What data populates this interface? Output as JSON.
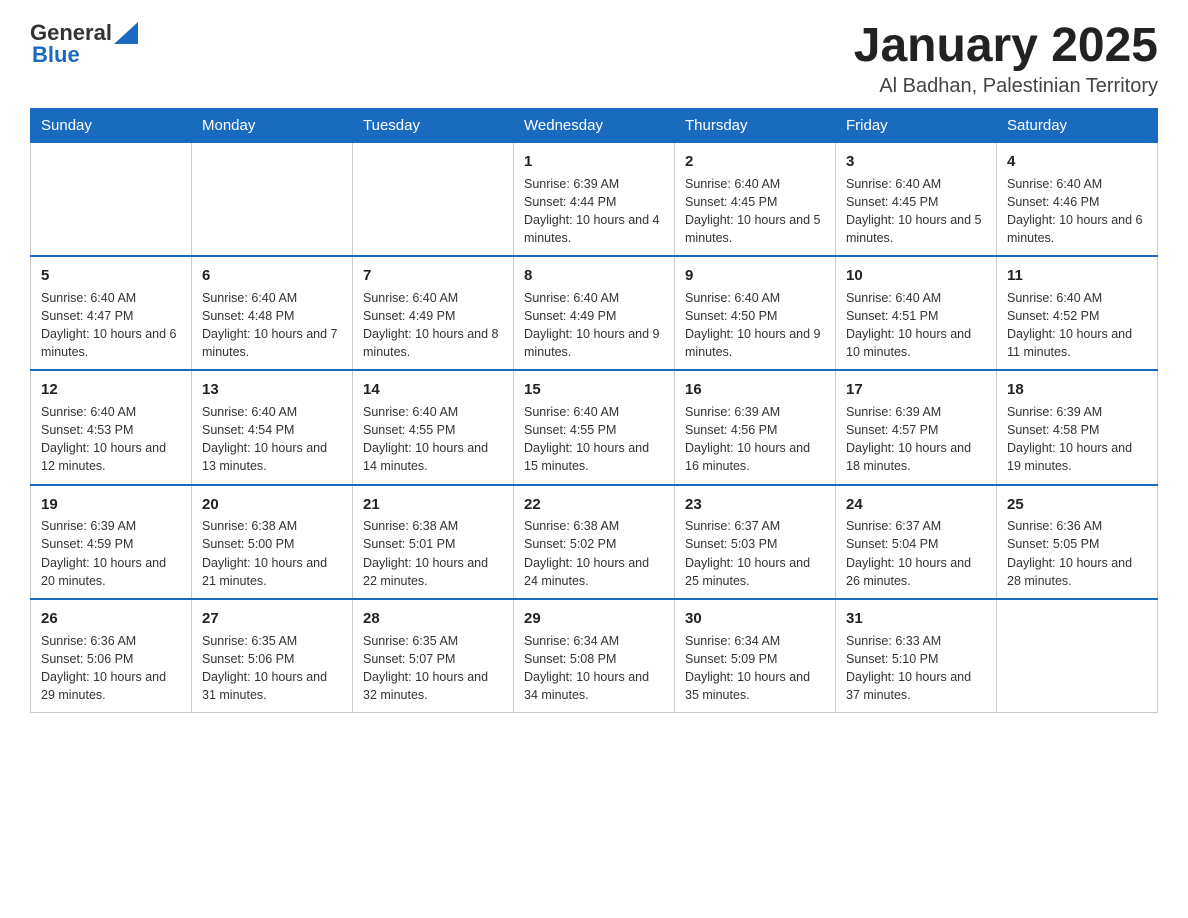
{
  "header": {
    "logo_general": "General",
    "logo_blue": "Blue",
    "month_title": "January 2025",
    "location": "Al Badhan, Palestinian Territory"
  },
  "days_of_week": [
    "Sunday",
    "Monday",
    "Tuesday",
    "Wednesday",
    "Thursday",
    "Friday",
    "Saturday"
  ],
  "weeks": [
    [
      {
        "day": "",
        "info": ""
      },
      {
        "day": "",
        "info": ""
      },
      {
        "day": "",
        "info": ""
      },
      {
        "day": "1",
        "info": "Sunrise: 6:39 AM\nSunset: 4:44 PM\nDaylight: 10 hours and 4 minutes."
      },
      {
        "day": "2",
        "info": "Sunrise: 6:40 AM\nSunset: 4:45 PM\nDaylight: 10 hours and 5 minutes."
      },
      {
        "day": "3",
        "info": "Sunrise: 6:40 AM\nSunset: 4:45 PM\nDaylight: 10 hours and 5 minutes."
      },
      {
        "day": "4",
        "info": "Sunrise: 6:40 AM\nSunset: 4:46 PM\nDaylight: 10 hours and 6 minutes."
      }
    ],
    [
      {
        "day": "5",
        "info": "Sunrise: 6:40 AM\nSunset: 4:47 PM\nDaylight: 10 hours and 6 minutes."
      },
      {
        "day": "6",
        "info": "Sunrise: 6:40 AM\nSunset: 4:48 PM\nDaylight: 10 hours and 7 minutes."
      },
      {
        "day": "7",
        "info": "Sunrise: 6:40 AM\nSunset: 4:49 PM\nDaylight: 10 hours and 8 minutes."
      },
      {
        "day": "8",
        "info": "Sunrise: 6:40 AM\nSunset: 4:49 PM\nDaylight: 10 hours and 9 minutes."
      },
      {
        "day": "9",
        "info": "Sunrise: 6:40 AM\nSunset: 4:50 PM\nDaylight: 10 hours and 9 minutes."
      },
      {
        "day": "10",
        "info": "Sunrise: 6:40 AM\nSunset: 4:51 PM\nDaylight: 10 hours and 10 minutes."
      },
      {
        "day": "11",
        "info": "Sunrise: 6:40 AM\nSunset: 4:52 PM\nDaylight: 10 hours and 11 minutes."
      }
    ],
    [
      {
        "day": "12",
        "info": "Sunrise: 6:40 AM\nSunset: 4:53 PM\nDaylight: 10 hours and 12 minutes."
      },
      {
        "day": "13",
        "info": "Sunrise: 6:40 AM\nSunset: 4:54 PM\nDaylight: 10 hours and 13 minutes."
      },
      {
        "day": "14",
        "info": "Sunrise: 6:40 AM\nSunset: 4:55 PM\nDaylight: 10 hours and 14 minutes."
      },
      {
        "day": "15",
        "info": "Sunrise: 6:40 AM\nSunset: 4:55 PM\nDaylight: 10 hours and 15 minutes."
      },
      {
        "day": "16",
        "info": "Sunrise: 6:39 AM\nSunset: 4:56 PM\nDaylight: 10 hours and 16 minutes."
      },
      {
        "day": "17",
        "info": "Sunrise: 6:39 AM\nSunset: 4:57 PM\nDaylight: 10 hours and 18 minutes."
      },
      {
        "day": "18",
        "info": "Sunrise: 6:39 AM\nSunset: 4:58 PM\nDaylight: 10 hours and 19 minutes."
      }
    ],
    [
      {
        "day": "19",
        "info": "Sunrise: 6:39 AM\nSunset: 4:59 PM\nDaylight: 10 hours and 20 minutes."
      },
      {
        "day": "20",
        "info": "Sunrise: 6:38 AM\nSunset: 5:00 PM\nDaylight: 10 hours and 21 minutes."
      },
      {
        "day": "21",
        "info": "Sunrise: 6:38 AM\nSunset: 5:01 PM\nDaylight: 10 hours and 22 minutes."
      },
      {
        "day": "22",
        "info": "Sunrise: 6:38 AM\nSunset: 5:02 PM\nDaylight: 10 hours and 24 minutes."
      },
      {
        "day": "23",
        "info": "Sunrise: 6:37 AM\nSunset: 5:03 PM\nDaylight: 10 hours and 25 minutes."
      },
      {
        "day": "24",
        "info": "Sunrise: 6:37 AM\nSunset: 5:04 PM\nDaylight: 10 hours and 26 minutes."
      },
      {
        "day": "25",
        "info": "Sunrise: 6:36 AM\nSunset: 5:05 PM\nDaylight: 10 hours and 28 minutes."
      }
    ],
    [
      {
        "day": "26",
        "info": "Sunrise: 6:36 AM\nSunset: 5:06 PM\nDaylight: 10 hours and 29 minutes."
      },
      {
        "day": "27",
        "info": "Sunrise: 6:35 AM\nSunset: 5:06 PM\nDaylight: 10 hours and 31 minutes."
      },
      {
        "day": "28",
        "info": "Sunrise: 6:35 AM\nSunset: 5:07 PM\nDaylight: 10 hours and 32 minutes."
      },
      {
        "day": "29",
        "info": "Sunrise: 6:34 AM\nSunset: 5:08 PM\nDaylight: 10 hours and 34 minutes."
      },
      {
        "day": "30",
        "info": "Sunrise: 6:34 AM\nSunset: 5:09 PM\nDaylight: 10 hours and 35 minutes."
      },
      {
        "day": "31",
        "info": "Sunrise: 6:33 AM\nSunset: 5:10 PM\nDaylight: 10 hours and 37 minutes."
      },
      {
        "day": "",
        "info": ""
      }
    ]
  ]
}
